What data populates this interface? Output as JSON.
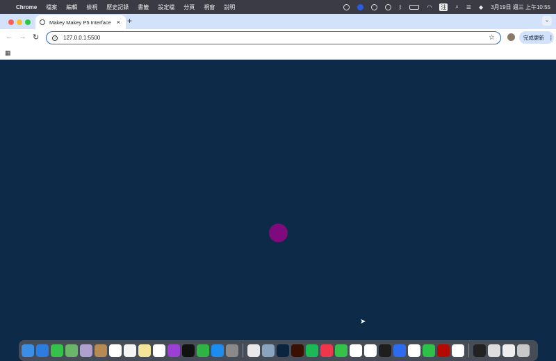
{
  "menubar": {
    "app": "Chrome",
    "items": [
      "檔案",
      "編輯",
      "檢視",
      "歷史記錄",
      "書籤",
      "設定檔",
      "分頁",
      "視窗",
      "說明"
    ],
    "input_method": "注",
    "datetime": "3月19日 週三 上午10:55"
  },
  "tab": {
    "title": "Makey Makey P5 Interface",
    "close": "×",
    "new": "+"
  },
  "toolbar": {
    "url": "127.0.0.1:5500",
    "update_label": "完成更新"
  },
  "dock": {
    "apps": [
      {
        "name": "finder",
        "color": "#3a8ee6"
      },
      {
        "name": "safari",
        "color": "#2d7de0"
      },
      {
        "name": "facetime",
        "color": "#35c24b"
      },
      {
        "name": "maps",
        "color": "#6bb56b"
      },
      {
        "name": "launchpad",
        "color": "#b0a0d0"
      },
      {
        "name": "contacts",
        "color": "#b58a55"
      },
      {
        "name": "calendar",
        "color": "#ffffff"
      },
      {
        "name": "reminders",
        "color": "#f4f4f4"
      },
      {
        "name": "notes",
        "color": "#f6e39a"
      },
      {
        "name": "freeform",
        "color": "#ffffff"
      },
      {
        "name": "podcasts",
        "color": "#9b3fd5"
      },
      {
        "name": "tv",
        "color": "#111111"
      },
      {
        "name": "numbers",
        "color": "#2fb344"
      },
      {
        "name": "app-store",
        "color": "#1d8cf0"
      },
      {
        "name": "system-settings",
        "color": "#8a8a8a"
      },
      {
        "name": "sep"
      },
      {
        "name": "chrome",
        "color": "#e8e8e8"
      },
      {
        "name": "preview",
        "color": "#8aa4c0"
      },
      {
        "name": "photoshop",
        "color": "#0b2440"
      },
      {
        "name": "illustrator",
        "color": "#3a1000"
      },
      {
        "name": "spotify",
        "color": "#1db954"
      },
      {
        "name": "music",
        "color": "#f0364a"
      },
      {
        "name": "messages",
        "color": "#35c24b"
      },
      {
        "name": "vscode",
        "color": "#ffffff"
      },
      {
        "name": "word",
        "color": "#ffffff"
      },
      {
        "name": "figma",
        "color": "#1e1e1e"
      },
      {
        "name": "zoom",
        "color": "#2d6cf0"
      },
      {
        "name": "excel",
        "color": "#ffffff"
      },
      {
        "name": "wechat",
        "color": "#2dc14a"
      },
      {
        "name": "acrobat",
        "color": "#b30b00"
      },
      {
        "name": "teams",
        "color": "#ffffff"
      },
      {
        "name": "sep"
      },
      {
        "name": "window-1",
        "color": "#222222"
      },
      {
        "name": "window-2",
        "color": "#dddddd"
      },
      {
        "name": "window-3",
        "color": "#eeeeee"
      },
      {
        "name": "trash",
        "color": "#c8c8c8"
      }
    ]
  },
  "canvas": {
    "background": "#0d2b48",
    "dot_color": "#7e0a7e"
  }
}
